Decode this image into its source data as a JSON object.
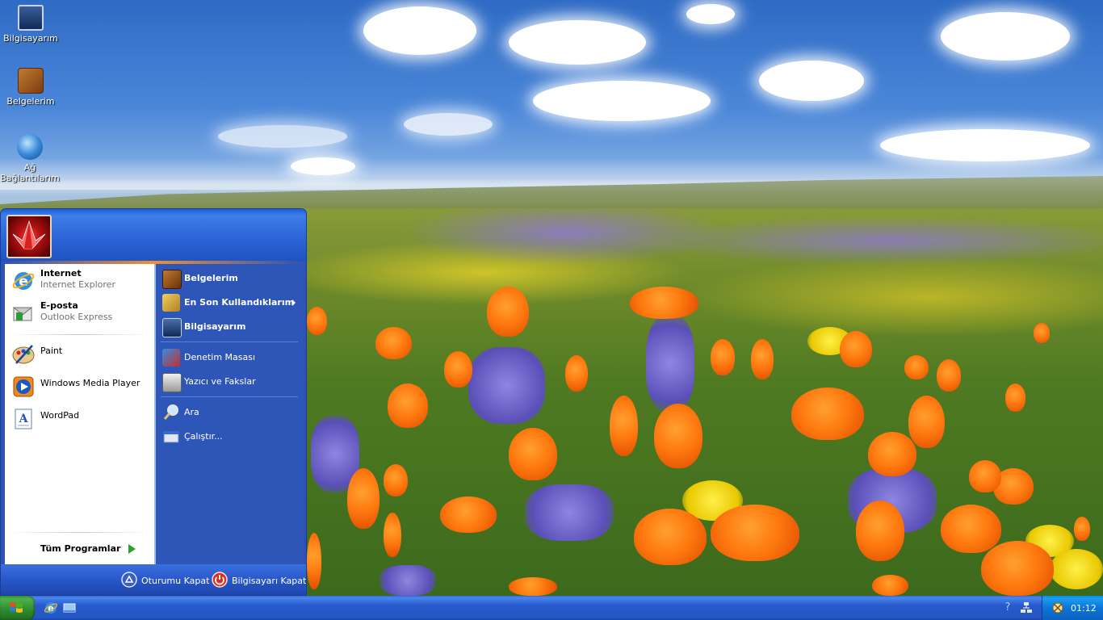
{
  "desktop": {
    "icons": [
      {
        "label": "Bilgisayarım"
      },
      {
        "label": "Belgelerim"
      },
      {
        "label": "Ağ Bağlantılarım"
      }
    ]
  },
  "start_menu": {
    "pinned": [
      {
        "title": "Internet",
        "subtitle": "Internet Explorer",
        "icon": "internet-explorer-icon"
      },
      {
        "title": "E-posta",
        "subtitle": "Outlook Express",
        "icon": "outlook-express-icon"
      }
    ],
    "recent": [
      {
        "label": "Paint",
        "icon": "paint-icon"
      },
      {
        "label": "Windows Media Player",
        "icon": "media-player-icon"
      },
      {
        "label": "WordPad",
        "icon": "wordpad-icon"
      }
    ],
    "all_programs": "Tüm Programlar",
    "right": [
      {
        "label": "Belgelerim",
        "bold": true,
        "icon": "documents-icon"
      },
      {
        "label": "En Son Kullandıklarım",
        "bold": true,
        "icon": "recent-documents-icon",
        "submenu": true
      },
      {
        "label": "Bilgisayarım",
        "bold": true,
        "icon": "my-computer-icon"
      },
      {
        "label": "Denetim Masası",
        "bold": false,
        "icon": "control-panel-icon"
      },
      {
        "label": "Yazıcı ve Fakslar",
        "bold": false,
        "icon": "printers-icon"
      },
      {
        "label": "Ara",
        "bold": false,
        "icon": "search-icon"
      },
      {
        "label": "Çalıştır...",
        "bold": false,
        "icon": "run-icon"
      }
    ],
    "footer": {
      "logoff": "Oturumu Kapat",
      "shutdown": "Bilgisayarı Kapat"
    }
  },
  "taskbar": {
    "clock": "01:12",
    "quick_launch": [
      "internet-explorer-icon",
      "show-desktop-icon"
    ],
    "tray_icons": [
      "help-icon",
      "network-icon",
      "tray-app-icon"
    ],
    "help_glyph": "?",
    "colors": {
      "start_green": "#2d8a2d",
      "taskbar_blue": "#2457c4",
      "tray_blue": "#0d74d8"
    }
  }
}
